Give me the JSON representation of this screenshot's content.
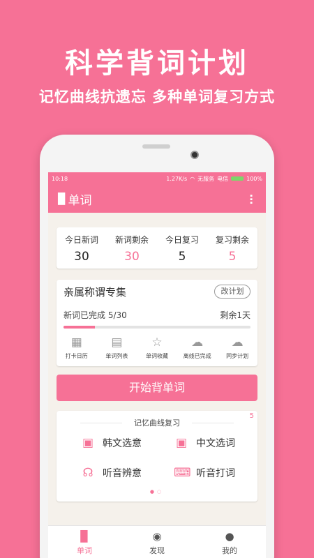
{
  "promo": {
    "title": "科学背词计划",
    "subtitle": "记忆曲线抗遗忘 多种单词复习方式"
  },
  "status_bar": {
    "time": "10:18",
    "speed": "1.27K/s",
    "service": "无服务",
    "carrier": "电信",
    "battery": "100%"
  },
  "app_bar": {
    "title": "单词",
    "menu_icon": "more-vertical-icon"
  },
  "stats": [
    {
      "label": "今日新词",
      "value": "30",
      "highlight": false
    },
    {
      "label": "新词剩余",
      "value": "30",
      "highlight": true
    },
    {
      "label": "今日复习",
      "value": "5",
      "highlight": false
    },
    {
      "label": "复习剩余",
      "value": "5",
      "highlight": true
    }
  ],
  "plan": {
    "title": "亲属称谓专集",
    "change_button": "改计划",
    "progress_label": "新词已完成 5/30",
    "remaining": "剩余1天",
    "progress_fraction": 0.167,
    "actions": [
      {
        "label": "打卡日历",
        "icon": "calendar-icon"
      },
      {
        "label": "单词列表",
        "icon": "document-icon"
      },
      {
        "label": "单词收藏",
        "icon": "star-icon"
      },
      {
        "label": "离线已完成",
        "icon": "cloud-download-icon"
      },
      {
        "label": "同步计划",
        "icon": "cloud-upload-icon"
      }
    ]
  },
  "start_button": "开始背单词",
  "review": {
    "title": "记忆曲线复习",
    "badge": "5",
    "modes": [
      {
        "label": "韩文选意",
        "icon": "card-list-icon"
      },
      {
        "label": "中文选词",
        "icon": "card-list-icon"
      },
      {
        "label": "听音辨意",
        "icon": "headphones-icon"
      },
      {
        "label": "听音打词",
        "icon": "keyboard-icon"
      }
    ]
  },
  "tabs": [
    {
      "label": "单词",
      "icon": "book-icon",
      "active": true
    },
    {
      "label": "发现",
      "icon": "compass-icon",
      "active": false
    },
    {
      "label": "我的",
      "icon": "person-icon",
      "active": false
    }
  ],
  "colors": {
    "accent": "#f67196",
    "background": "#f5f1eb"
  }
}
